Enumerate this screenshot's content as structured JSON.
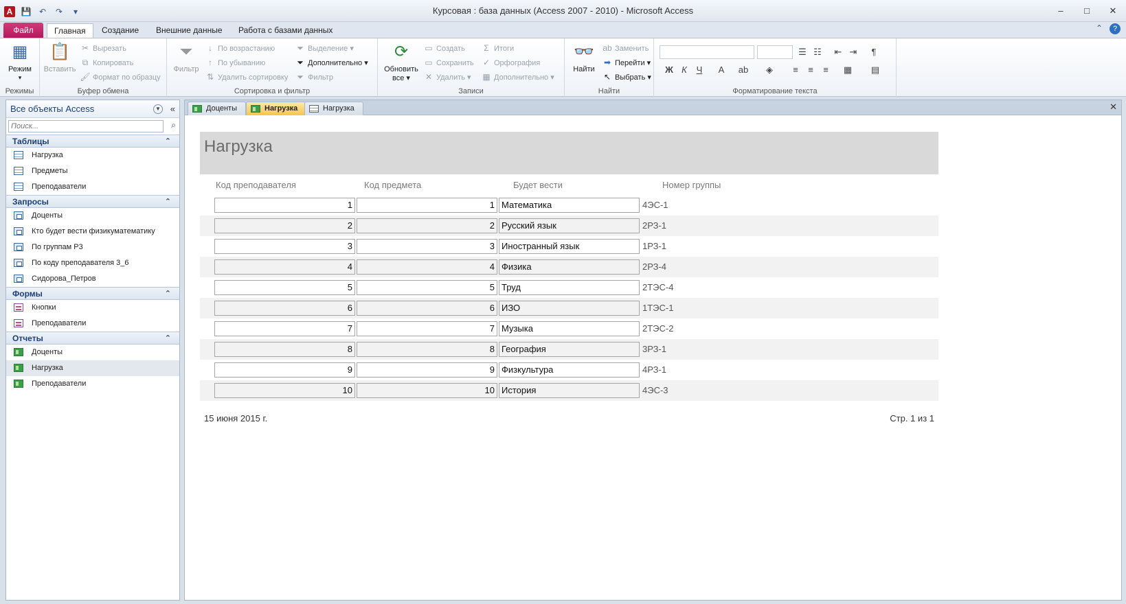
{
  "window": {
    "title": "Курсовая : база данных (Access 2007 - 2010)  -  Microsoft Access",
    "app_icon": "A",
    "min": "–",
    "max": "□",
    "close": "✕"
  },
  "ribbon": {
    "tabs": {
      "file": "Файл",
      "home": "Главная",
      "create": "Создание",
      "external": "Внешние данные",
      "dbtools": "Работа с базами данных"
    },
    "groups": {
      "views": {
        "label": "Режимы",
        "mode": "Режим"
      },
      "clipboard": {
        "label": "Буфер обмена",
        "paste": "Вставить",
        "cut": "Вырезать",
        "copy": "Копировать",
        "format_painter": "Формат по образцу"
      },
      "sort_filter": {
        "label": "Сортировка и фильтр",
        "filter_big": "Фильтр",
        "asc": "По возрастанию",
        "desc": "По убыванию",
        "remove_sort": "Удалить сортировку",
        "selection": "Выделение",
        "advanced": "Дополнительно",
        "toggle_filter": "Фильтр"
      },
      "records": {
        "label": "Записи",
        "refresh_line1": "Обновить",
        "refresh_line2": "все",
        "new": "Создать",
        "save": "Сохранить",
        "delete": "Удалить",
        "totals": "Итоги",
        "spelling": "Орфография",
        "more": "Дополнительно"
      },
      "find": {
        "label": "Найти",
        "find": "Найти",
        "replace": "Заменить",
        "goto": "Перейти",
        "select": "Выбрать"
      },
      "text_format": {
        "label": "Форматирование текста"
      }
    }
  },
  "nav": {
    "header": "Все объекты Access",
    "search_placeholder": "Поиск...",
    "groups": [
      {
        "title": "Таблицы",
        "icon": "table-icon",
        "items": [
          "Нагрузка",
          "Предметы",
          "Преподаватели"
        ]
      },
      {
        "title": "Запросы",
        "icon": "query-icon",
        "items": [
          "Доценты",
          "Кто будет вести физикуматематику",
          "По группам Р3",
          "По коду преподавателя 3_6",
          "Сидорова_Петров"
        ]
      },
      {
        "title": "Формы",
        "icon": "form-icon",
        "items": [
          "Кнопки",
          "Преподаватели"
        ]
      },
      {
        "title": "Отчеты",
        "icon": "report-icon",
        "items": [
          "Доценты",
          "Нагрузка",
          "Преподаватели"
        ]
      }
    ],
    "selected": "Отчеты/Нагрузка"
  },
  "doc_tabs": [
    "Доценты",
    "Нагрузка",
    "Нагрузка"
  ],
  "report": {
    "title": "Нагрузка",
    "columns": [
      "Код преподавателя",
      "Код предмета",
      "Будет вести",
      "Номер группы"
    ],
    "rows": [
      {
        "teacher": "1",
        "subject": "1",
        "name": "Математика",
        "group": "4ЭС-1"
      },
      {
        "teacher": "2",
        "subject": "2",
        "name": "Русский язык",
        "group": "2РЗ-1"
      },
      {
        "teacher": "3",
        "subject": "3",
        "name": "Иностранный язык",
        "group": "1РЗ-1"
      },
      {
        "teacher": "4",
        "subject": "4",
        "name": "Физика",
        "group": "2РЗ-4"
      },
      {
        "teacher": "5",
        "subject": "5",
        "name": "Труд",
        "group": "2ТЭС-4"
      },
      {
        "teacher": "6",
        "subject": "6",
        "name": "ИЗО",
        "group": "1ТЭС-1"
      },
      {
        "teacher": "7",
        "subject": "7",
        "name": "Музыка",
        "group": "2ТЭС-2"
      },
      {
        "teacher": "8",
        "subject": "8",
        "name": "География",
        "group": "3РЗ-1"
      },
      {
        "teacher": "9",
        "subject": "9",
        "name": "Физкультура",
        "group": "4РЗ-1"
      },
      {
        "teacher": "10",
        "subject": "10",
        "name": "История",
        "group": "4ЭС-3"
      }
    ],
    "footer_date": "15 июня 2015 г.",
    "footer_page": "Стр. 1 из 1"
  }
}
